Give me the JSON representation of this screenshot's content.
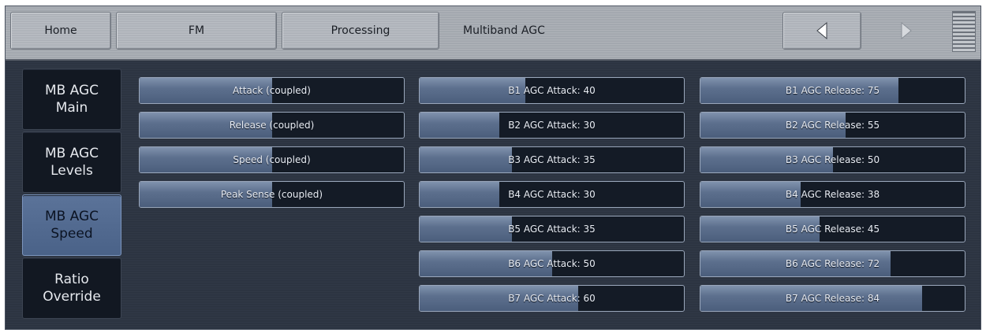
{
  "header": {
    "home_label": "Home",
    "fm_label": "FM",
    "processing_label": "Processing",
    "current_label": "Multiband AGC",
    "nav_icons": [
      "arrow-left-icon",
      "arrow-right-icon",
      "menu-icon"
    ]
  },
  "sidebar": {
    "tabs": [
      {
        "line1": "MB AGC",
        "line2": "Main",
        "active": false
      },
      {
        "line1": "MB AGC",
        "line2": "Levels",
        "active": false
      },
      {
        "line1": "MB AGC",
        "line2": "Speed",
        "active": true
      },
      {
        "line1": "Ratio",
        "line2": "Override",
        "active": false
      }
    ]
  },
  "coupled_controls": [
    {
      "label": "Attack (coupled)",
      "level": 0.5
    },
    {
      "label": "Release (coupled)",
      "level": 0.5
    },
    {
      "label": "Speed (coupled)",
      "level": 0.5
    },
    {
      "label": "Peak Sense (coupled)",
      "level": 0.5
    }
  ],
  "attack_controls": [
    {
      "label": "B1 AGC Attack: 40",
      "level": 0.4
    },
    {
      "label": "B2 AGC Attack: 30",
      "level": 0.3
    },
    {
      "label": "B3 AGC Attack: 35",
      "level": 0.35
    },
    {
      "label": "B4 AGC Attack: 30",
      "level": 0.3
    },
    {
      "label": "B5 AGC Attack: 35",
      "level": 0.35
    },
    {
      "label": "B6 AGC Attack: 50",
      "level": 0.5
    },
    {
      "label": "B7 AGC Attack: 60",
      "level": 0.6
    }
  ],
  "release_controls": [
    {
      "label": "B1 AGC Release: 75",
      "level": 0.75
    },
    {
      "label": "B2 AGC Release: 55",
      "level": 0.55
    },
    {
      "label": "B3 AGC Release: 50",
      "level": 0.5
    },
    {
      "label": "B4 AGC Release: 38",
      "level": 0.38
    },
    {
      "label": "B5 AGC Release: 45",
      "level": 0.45
    },
    {
      "label": "B6 AGC Release: 72",
      "level": 0.72
    },
    {
      "label": "B7 AGC Release: 84",
      "level": 0.84
    }
  ],
  "colors": {
    "accent_active_tab": "#5b7399",
    "button_fill": "#5d708e",
    "button_track": "#141b26"
  }
}
